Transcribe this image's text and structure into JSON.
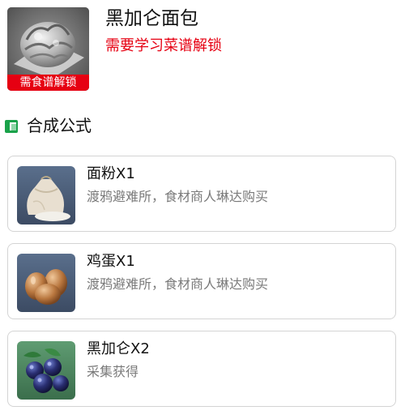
{
  "item": {
    "name": "黑加仑面包",
    "unlock_hint": "需要学习菜谱解锁",
    "locked_badge": "需食谱解锁",
    "image_icon": "bread-icon"
  },
  "section": {
    "title": "合成公式",
    "icon": "square-bullet-icon",
    "accent_color": "#1aa24a"
  },
  "ingredients": [
    {
      "name": "面粉X1",
      "source": "渡鸦避难所，食材商人琳达购买",
      "icon": "flour-sack-icon"
    },
    {
      "name": "鸡蛋X1",
      "source": "渡鸦避难所，食材商人琳达购买",
      "icon": "eggs-icon"
    },
    {
      "name": "黑加仑X2",
      "source": "采集获得",
      "icon": "blackcurrant-icon"
    }
  ],
  "colors": {
    "warning_red": "#e60012",
    "card_border": "#d4d4d4",
    "secondary_text": "#7a7a7a"
  }
}
